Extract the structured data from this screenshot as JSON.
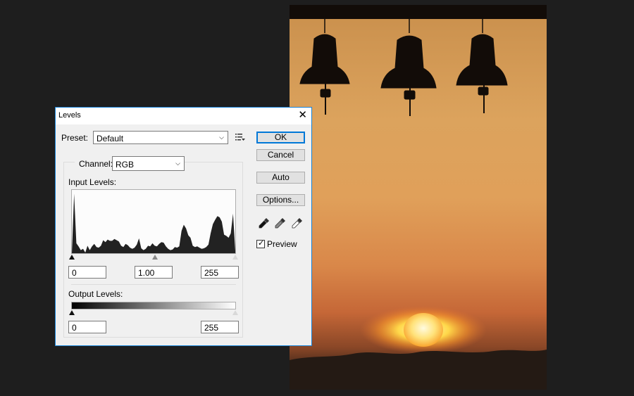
{
  "dialog": {
    "title": "Levels",
    "close_glyph": "✕",
    "preset_label": "Preset:",
    "preset_value": "Default",
    "channel_label": "Channel:",
    "channel_value": "RGB",
    "input_levels_label": "Input Levels:",
    "input_black": "0",
    "input_gamma": "1.00",
    "input_white": "255",
    "output_levels_label": "Output Levels:",
    "output_black": "0",
    "output_white": "255",
    "buttons": {
      "ok": "OK",
      "cancel": "Cancel",
      "auto": "Auto",
      "options": "Options..."
    },
    "preview_label": "Preview",
    "preview_checked": true
  },
  "icons": {
    "close": "close-icon",
    "dropdown": "chevron-down-icon",
    "preset_menu": "preset-menu-icon",
    "black_point": "black-eyedropper-icon",
    "gray_point": "gray-eyedropper-icon",
    "white_point": "white-eyedropper-icon"
  },
  "colors": {
    "accent": "#0078d7",
    "dialog_bg": "#f0f0f0",
    "workspace_bg": "#1e1e1e",
    "histogram_fill": "#222222"
  },
  "histogram_profile": [
    0,
    96,
    16,
    11,
    5,
    7,
    1,
    12,
    5,
    11,
    15,
    10,
    9,
    12,
    21,
    18,
    22,
    20,
    20,
    23,
    21,
    19,
    12,
    10,
    15,
    13,
    9,
    7,
    9,
    14,
    24,
    8,
    5,
    7,
    12,
    11,
    16,
    12,
    11,
    15,
    18,
    17,
    11,
    7,
    5,
    6,
    10,
    9,
    11,
    36,
    46,
    40,
    29,
    25,
    12,
    10,
    11,
    9,
    7,
    8,
    10,
    14,
    32,
    47,
    54,
    60,
    58,
    51,
    30,
    28,
    25,
    32,
    64,
    4
  ]
}
